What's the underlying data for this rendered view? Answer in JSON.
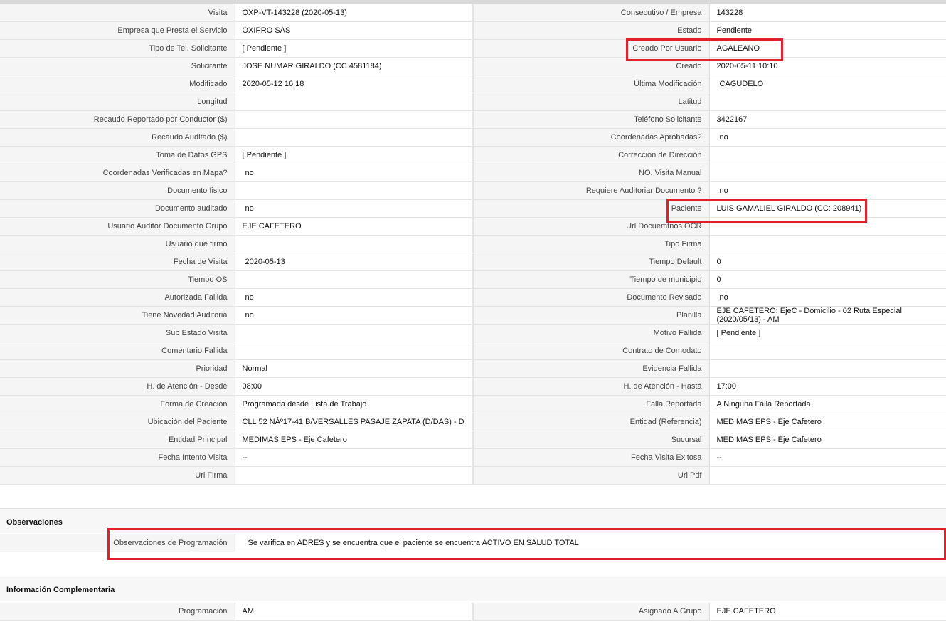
{
  "main": {
    "rows": [
      {
        "l1": "Visita",
        "v1": "OXP-VT-143228 (2020-05-13)",
        "l2": "Consecutivo / Empresa",
        "v2": "143228"
      },
      {
        "l1": "Empresa que Presta el Servicio",
        "v1": "OXIPRO SAS",
        "l2": "Estado",
        "v2": "Pendiente"
      },
      {
        "l1": "Tipo de Tel. Solicitante",
        "v1": "[ Pendiente ]",
        "l2": "Creado Por Usuario",
        "v2": "AGALEANO"
      },
      {
        "l1": "Solicitante",
        "v1": "JOSE NUMAR GIRALDO (CC 4581184)",
        "l2": "Creado",
        "v2": "2020-05-11 10:10"
      },
      {
        "l1": "Modificado",
        "v1": "2020-05-12 16:18",
        "l2": "Última Modificación",
        "v2": "CAGUDELO"
      },
      {
        "l1": "Longitud",
        "v1": "",
        "l2": "Latitud",
        "v2": ""
      },
      {
        "l1": "Recaudo Reportado por Conductor ($)",
        "v1": "",
        "l2": "Teléfono Solicitante",
        "v2": "3422167"
      },
      {
        "l1": "Recaudo Auditado ($)",
        "v1": "",
        "l2": "Coordenadas Aprobadas?",
        "v2": "no"
      },
      {
        "l1": "Toma de Datos GPS",
        "v1": "[ Pendiente ]",
        "l2": "Corrección de Dirección",
        "v2": ""
      },
      {
        "l1": "Coordenadas Verificadas en Mapa?",
        "v1": "no",
        "l2": "NO. Visita Manual",
        "v2": ""
      },
      {
        "l1": "Documento fisico",
        "v1": "",
        "l2": "Requiere Auditoriar Documento ?",
        "v2": "no"
      },
      {
        "l1": "Documento auditado",
        "v1": "no",
        "l2": "Paciente",
        "v2": "LUIS GAMALIEL GIRALDO (CC: 208941)"
      },
      {
        "l1": "Usuario Auditor Documento Grupo",
        "v1": "EJE CAFETERO",
        "l2": "Url Docuemtnos OCR",
        "v2": ""
      },
      {
        "l1": "Usuario que firmo",
        "v1": "",
        "l2": "Tipo Firma",
        "v2": ""
      },
      {
        "l1": "Fecha de Visita",
        "v1": "2020-05-13",
        "l2": "Tiempo Default",
        "v2": "0"
      },
      {
        "l1": "Tiempo OS",
        "v1": "",
        "l2": "Tiempo de municipio",
        "v2": "0"
      },
      {
        "l1": "Autorizada Fallida",
        "v1": "no",
        "l2": "Documento Revisado",
        "v2": "no"
      },
      {
        "l1": "Tiene Novedad Auditoria",
        "v1": "no",
        "l2": "Planilla",
        "v2": "EJE CAFETERO: EjeC - Domicilio - 02 Ruta Especial (2020/05/13) - AM"
      },
      {
        "l1": "Sub Estado Visita",
        "v1": "",
        "l2": "Motivo Fallida",
        "v2": "[ Pendiente ]"
      },
      {
        "l1": "Comentario Fallida",
        "v1": "",
        "l2": "Contrato de Comodato",
        "v2": ""
      },
      {
        "l1": "Prioridad",
        "v1": "Normal",
        "l2": "Evidencia Fallida",
        "v2": ""
      },
      {
        "l1": "H. de Atención - Desde",
        "v1": "08:00",
        "l2": "H. de Atención - Hasta",
        "v2": "17:00"
      },
      {
        "l1": "Forma de Creación",
        "v1": "Programada desde Lista de Trabajo",
        "l2": "Falla Reportada",
        "v2": "A Ninguna Falla Reportada"
      },
      {
        "l1": "Ubicación del Paciente",
        "v1": "CLL 52 NÂº17-41 B/VERSALLES PASAJE ZAPATA (D/DAS) - D",
        "l2": "Entidad (Referencia)",
        "v2": "MEDIMAS EPS - Eje Cafetero"
      },
      {
        "l1": "Entidad Principal",
        "v1": "MEDIMAS EPS - Eje Cafetero",
        "l2": "Sucursal",
        "v2": "MEDIMAS EPS - Eje Cafetero"
      },
      {
        "l1": "Fecha Intento Visita",
        "v1": "--",
        "l2": "Fecha Visita Exitosa",
        "v2": "--"
      },
      {
        "l1": "Url Firma",
        "v1": "",
        "l2": "Url Pdf",
        "v2": ""
      }
    ]
  },
  "observaciones": {
    "title": "Observaciones",
    "label": "Observaciones de Programación",
    "value": "Se varifica en ADRES y se encuentra que el paciente se encuentra ACTIVO EN SALUD TOTAL"
  },
  "complementaria": {
    "title": "Información Complementaria",
    "rows": [
      {
        "l1": "Programación",
        "v1": "AM",
        "l2": "Asignado A Grupo",
        "v2": "EJE CAFETERO"
      }
    ]
  },
  "colors": {
    "highlight": "#e0202a",
    "label_bg": "#f5f5f5",
    "section_bg": "#f7f7f7"
  }
}
